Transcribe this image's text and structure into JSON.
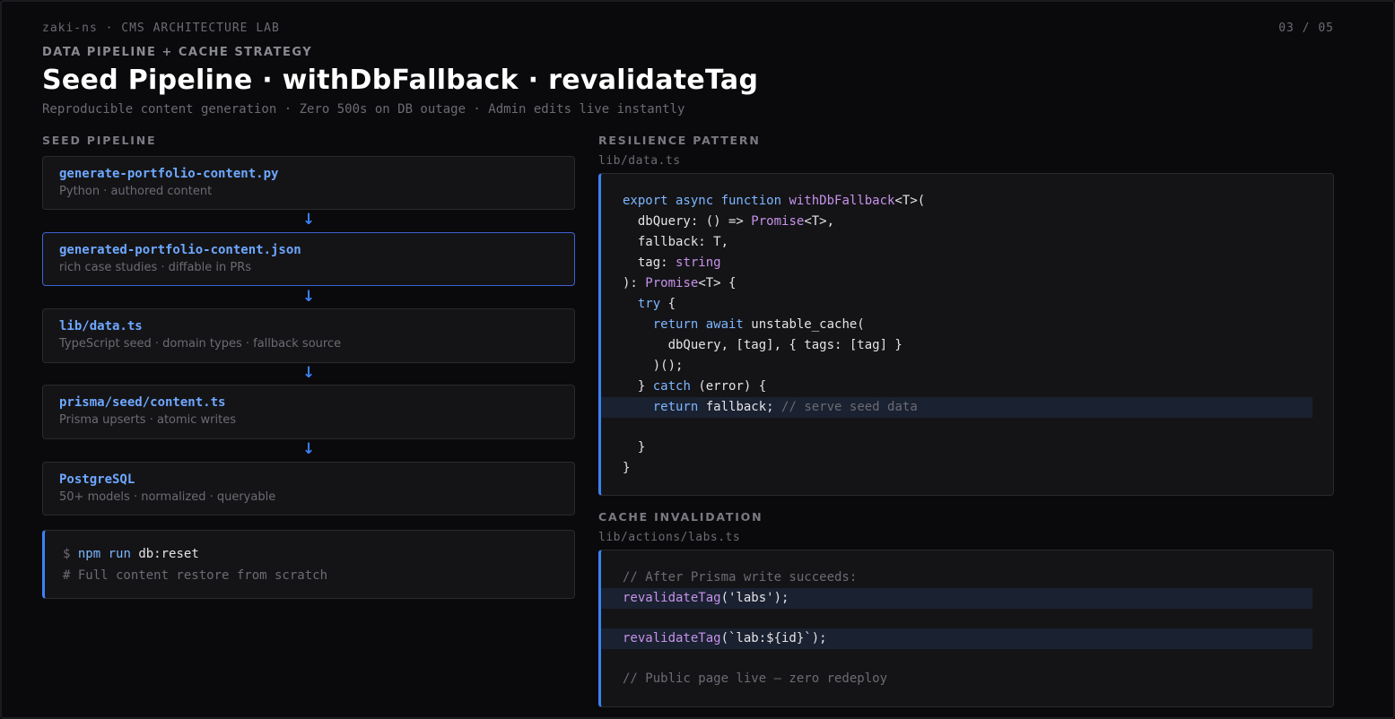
{
  "header": {
    "brand": "zaki-ns · CMS ARCHITECTURE LAB",
    "page_counter": "03 / 05",
    "eyebrow": "DATA PIPELINE + CACHE STRATEGY",
    "title": "Seed Pipeline · withDbFallback · revalidateTag",
    "subtitle": "Reproducible content generation · Zero 500s on DB outage · Admin edits live instantly"
  },
  "seed_pipeline": {
    "label": "SEED PIPELINE",
    "arrow": "↓",
    "stages": [
      {
        "name": "generate-portfolio-content.py",
        "desc": "Python · authored content"
      },
      {
        "name": "generated-portfolio-content.json",
        "desc": "rich case studies · diffable in PRs"
      },
      {
        "name": "lib/data.ts",
        "desc": "TypeScript seed · domain types · fallback source"
      },
      {
        "name": "prisma/seed/content.ts",
        "desc": "Prisma upserts · atomic writes"
      },
      {
        "name": "PostgreSQL",
        "desc": "50+ models · normalized · queryable"
      }
    ],
    "terminal": {
      "prompt": "$",
      "cmd": "npm run",
      "arg": "db:reset",
      "comment": "# Full content restore from scratch"
    }
  },
  "resilience": {
    "label": "RESILIENCE PATTERN",
    "file": "lib/data.ts",
    "code": {
      "l1_kw": "export async function",
      "l1_fn": "withDbFallback",
      "l1_rest": "<T>(",
      "l2_a": "  dbQuery: () =>",
      "l2_ty": "Promise",
      "l2_b": "<T>,",
      "l3": "  fallback: T,",
      "l4_a": "  tag:",
      "l4_ty": "string",
      "l5_a": "):",
      "l5_ty": "Promise",
      "l5_b": "<T> {",
      "l6_kw": "try",
      "l6_b": " {",
      "l7_kw": "return await",
      "l7_b": " unstable_cache(",
      "l8": "      dbQuery, [tag], { tags: [tag] }",
      "l9": "    )();",
      "l10_a": "  }",
      "l10_kw": "catch",
      "l10_b": " (error) {",
      "l11_kw": "return",
      "l11_b": " fallback;",
      "l11_cm": "// serve seed data",
      "l13": "  }",
      "l14": "}"
    }
  },
  "cache": {
    "label": "CACHE INVALIDATION",
    "file": "lib/actions/labs.ts",
    "code": {
      "c1": "// After Prisma write succeeds:",
      "c2_fn": "revalidateTag",
      "c2_b": "('labs');",
      "c3_fn": "revalidateTag",
      "c3_b": "(`lab:${id}`);",
      "c4": "// Public page live — zero redeploy"
    }
  }
}
